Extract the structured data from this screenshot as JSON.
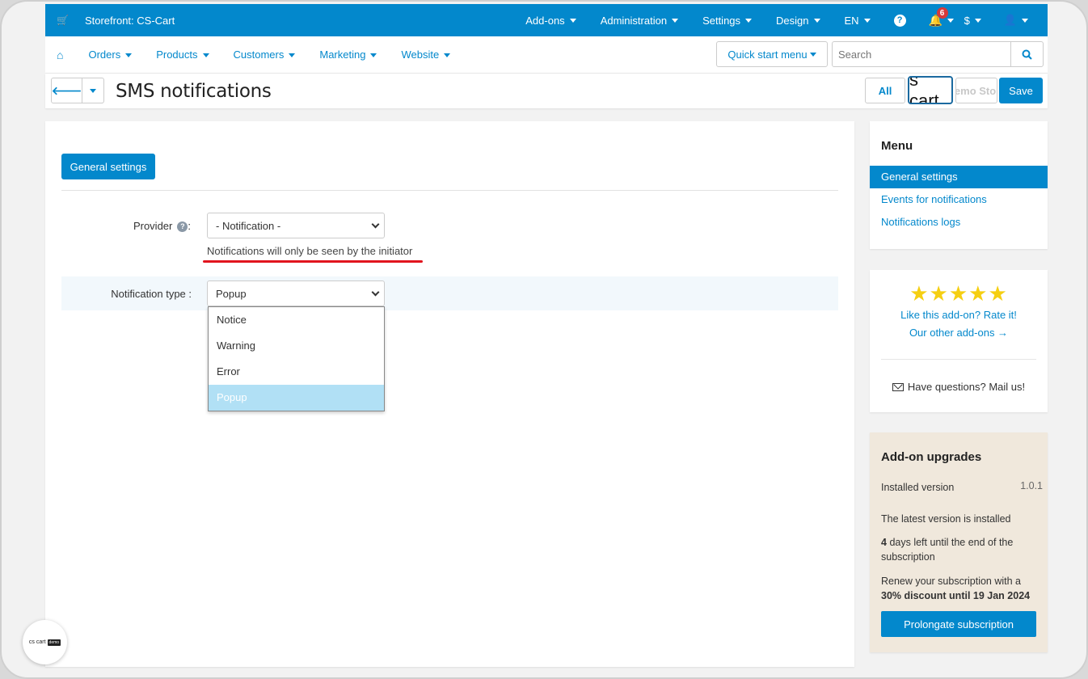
{
  "colors": {
    "accent": "#0388cc",
    "highlight_underline": "#e1141e",
    "star": "#f5cf12",
    "badge": "#d63a3a"
  },
  "topbar": {
    "store_label": "Storefront: CS-Cart",
    "nav": [
      "Add-ons",
      "Administration",
      "Settings",
      "Design",
      "EN"
    ],
    "help_symbol": "?",
    "notifications_count": "6",
    "currency": "$",
    "icons": {
      "cart": "cart-icon",
      "help": "help-icon",
      "bell": "bell-icon",
      "user": "user-icon"
    }
  },
  "subnav": {
    "items": [
      "Orders",
      "Products",
      "Customers",
      "Marketing",
      "Website"
    ],
    "quick_start": "Quick start menu",
    "search_placeholder": "Search"
  },
  "titlebar": {
    "title": "SMS notifications",
    "all_label": "All",
    "logo_text": "s cart",
    "demo_text": "Demo Store",
    "save_label": "Save"
  },
  "main": {
    "tab_label": "General settings",
    "provider_label": "Provider",
    "provider_suffix": ":",
    "provider_value": "- Notification -",
    "provider_hint": "Notifications will only be seen by the initiator",
    "type_label": "Notification type :",
    "type_value": "Popup",
    "type_options": [
      "Notice",
      "Warning",
      "Error",
      "Popup"
    ],
    "type_selected": "Popup"
  },
  "sidebar": {
    "menu_title": "Menu",
    "menu_items": [
      "General settings",
      "Events for notifications",
      "Notifications logs"
    ],
    "active_item": "General settings",
    "rating": 5,
    "rate_link": "Like this add-on? Rate it!",
    "other_link": "Our other add-ons →",
    "mail_text": "Have questions? Mail us!",
    "upgrades": {
      "title": "Add-on upgrades",
      "installed_label": "Installed version",
      "installed_version": "1.0.1",
      "latest_text": "The latest version is installed",
      "days_count": "4",
      "days_text": "days left until the end of the subscription",
      "renew_text": "Renew your subscription with a",
      "discount_text": "30% discount until 19 Jan 2024",
      "prolong_label": "Prolongate subscription"
    }
  },
  "floating_logo": {
    "text": "cs cart",
    "tag": "demo"
  }
}
